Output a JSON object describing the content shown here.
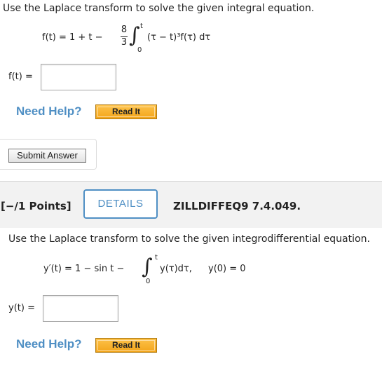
{
  "problem1": {
    "prompt": "Use the Laplace transform to solve the given integral equation.",
    "equation": {
      "lhs": "f(t) = 1 + t −",
      "frac_num": "8",
      "frac_den": "3",
      "integral": "∫",
      "upper": "t",
      "lower": "0",
      "integrand": "(τ − t)³f(τ) dτ"
    },
    "answer_label": "f(t) =",
    "answer_value": "",
    "need_help": "Need Help?",
    "read_it": "Read It"
  },
  "submit_label": "Submit Answer",
  "problem2": {
    "points": "[−/1 Points]",
    "details_label": "DETAILS",
    "problem_id": "ZILLDIFFEQ9 7.4.049.",
    "prompt": "Use the Laplace transform to solve the given integrodifferential equation.",
    "equation": {
      "lhs": "y′(t) = 1 − sin t −",
      "integral": "∫",
      "upper": "t",
      "lower": "0",
      "integrand": "y(τ)dτ,",
      "condition": "y(0) = 0"
    },
    "answer_label": "y(t) =",
    "answer_value": "",
    "need_help": "Need Help?",
    "read_it": "Read It"
  }
}
